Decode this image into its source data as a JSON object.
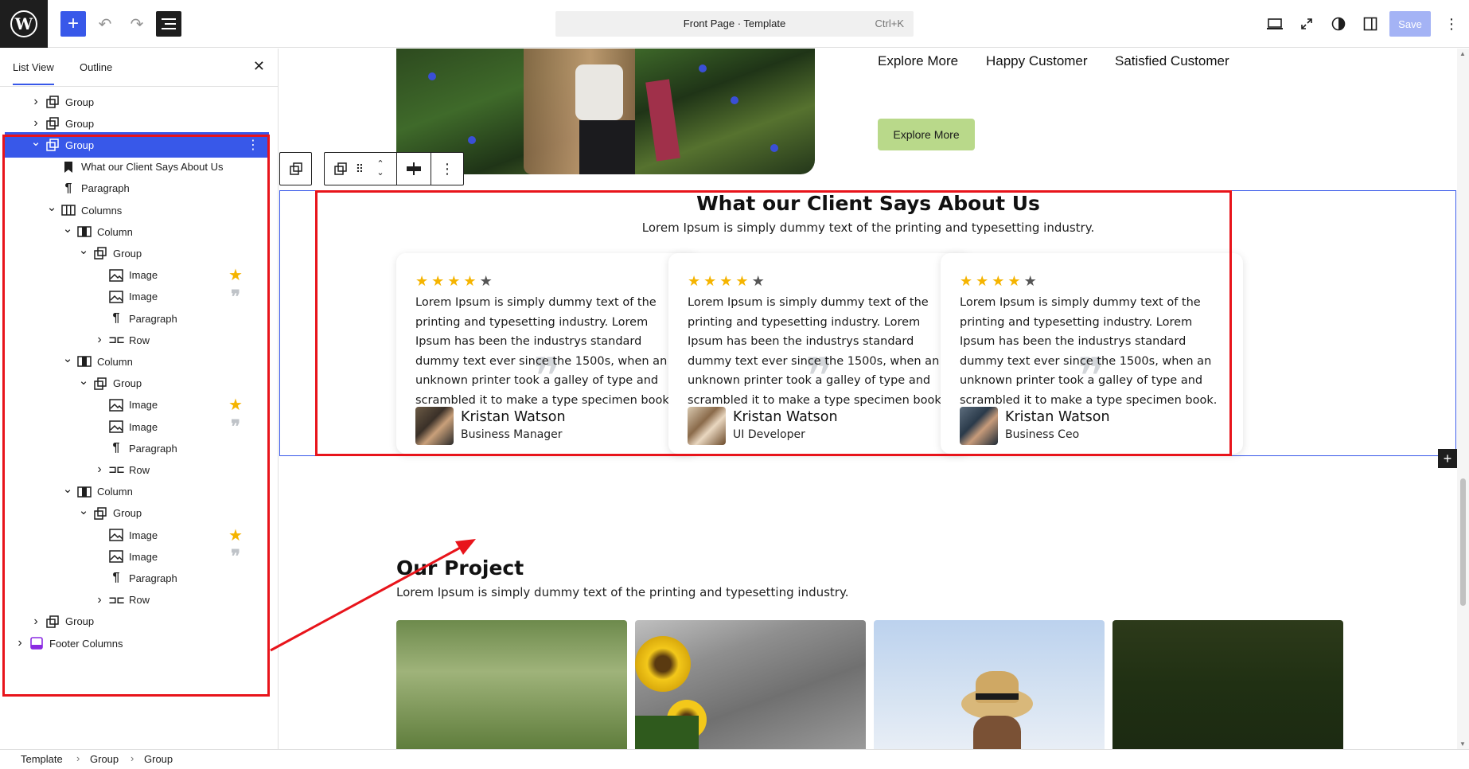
{
  "topbar": {
    "document_title": "Front Page · Template",
    "shortcut": "Ctrl+K",
    "save_label": "Save"
  },
  "sidebar": {
    "tab_list_view": "List View",
    "tab_outline": "Outline",
    "tree": [
      {
        "label": "Group",
        "icon": "group-icon",
        "depth": 0,
        "chevron": "right"
      },
      {
        "label": "Group",
        "icon": "group-icon",
        "depth": 0,
        "chevron": "right"
      },
      {
        "label": "Group",
        "icon": "group-icon",
        "depth": 0,
        "chevron": "down",
        "selected": true
      },
      {
        "label": "What our Client Says About Us",
        "icon": "bookmark-icon",
        "depth": 1
      },
      {
        "label": "Paragraph",
        "icon": "paragraph-icon",
        "depth": 1
      },
      {
        "label": "Columns",
        "icon": "columns-icon",
        "depth": 1,
        "chevron": "down"
      },
      {
        "label": "Column",
        "icon": "column-icon",
        "depth": 2,
        "chevron": "down"
      },
      {
        "label": "Group",
        "icon": "group-icon",
        "depth": 3,
        "chevron": "down"
      },
      {
        "label": "Image",
        "icon": "image-icon",
        "depth": 4,
        "badge": "star-badge-icon"
      },
      {
        "label": "Image",
        "icon": "image-icon",
        "depth": 4,
        "badge": "quote-badge-icon"
      },
      {
        "label": "Paragraph",
        "icon": "paragraph-icon",
        "depth": 4
      },
      {
        "label": "Row",
        "icon": "row-icon",
        "depth": 4,
        "chevron": "right"
      },
      {
        "label": "Column",
        "icon": "column-icon",
        "depth": 2,
        "chevron": "down"
      },
      {
        "label": "Group",
        "icon": "group-icon",
        "depth": 3,
        "chevron": "down"
      },
      {
        "label": "Image",
        "icon": "image-icon",
        "depth": 4,
        "badge": "star-badge-icon"
      },
      {
        "label": "Image",
        "icon": "image-icon",
        "depth": 4,
        "badge": "quote-badge-icon"
      },
      {
        "label": "Paragraph",
        "icon": "paragraph-icon",
        "depth": 4
      },
      {
        "label": "Row",
        "icon": "row-icon",
        "depth": 4,
        "chevron": "right"
      },
      {
        "label": "Column",
        "icon": "column-icon",
        "depth": 2,
        "chevron": "down"
      },
      {
        "label": "Group",
        "icon": "group-icon",
        "depth": 3,
        "chevron": "down"
      },
      {
        "label": "Image",
        "icon": "image-icon",
        "depth": 4,
        "badge": "star-badge-icon"
      },
      {
        "label": "Image",
        "icon": "image-icon",
        "depth": 4,
        "badge": "quote-badge-icon"
      },
      {
        "label": "Paragraph",
        "icon": "paragraph-icon",
        "depth": 4
      },
      {
        "label": "Row",
        "icon": "row-icon",
        "depth": 4,
        "chevron": "right"
      },
      {
        "label": "Group",
        "icon": "group-icon",
        "depth": 0,
        "chevron": "right"
      },
      {
        "label": "Footer Columns",
        "icon": "footer-columns-icon",
        "depth": -1,
        "chevron": "right"
      }
    ]
  },
  "breadcrumb": [
    "Template",
    "Group",
    "Group"
  ],
  "hero": {
    "stats": [
      "Explore More",
      "Happy Customer",
      "Satisfied Customer"
    ],
    "button_label": "Explore More"
  },
  "testimonials": {
    "title": "What our Client Says About Us",
    "subtitle": "Lorem Ipsum is simply dummy text of the printing and typesetting industry.",
    "quote_glyph": "❞",
    "cards": [
      {
        "rating": 4,
        "text": "Lorem Ipsum is simply dummy text of the printing and typesetting industry. Lorem Ipsum has been the industrys standard dummy text ever since the 1500s, when an unknown printer took a galley of type and scrambled it to make a type specimen book.",
        "name": "Kristan Watson",
        "role": "Business Manager"
      },
      {
        "rating": 4,
        "text": "Lorem Ipsum is simply dummy text of the printing and typesetting industry. Lorem Ipsum has been the industrys standard dummy text ever since the 1500s, when an unknown printer took a galley of type and scrambled it to make a type specimen book.",
        "name": "Kristan Watson",
        "role": "UI Developer"
      },
      {
        "rating": 4,
        "text": "Lorem Ipsum is simply dummy text of the printing and typesetting industry. Lorem Ipsum has been the industrys standard dummy text ever since the 1500s, when an unknown printer took a galley of type and scrambled it to make a type specimen book.",
        "name": "Kristan Watson",
        "role": "Business Ceo"
      }
    ]
  },
  "project": {
    "title": "Our Project",
    "subtitle": "Lorem Ipsum is simply dummy text of the printing and typesetting industry."
  },
  "colors": {
    "wp_blue": "#3858e9",
    "annotation_red": "#e8141b",
    "star_gold": "#f5b400",
    "star_empty": "#555555",
    "explore_green": "#b9d98a",
    "fab_green": "#44c316"
  }
}
